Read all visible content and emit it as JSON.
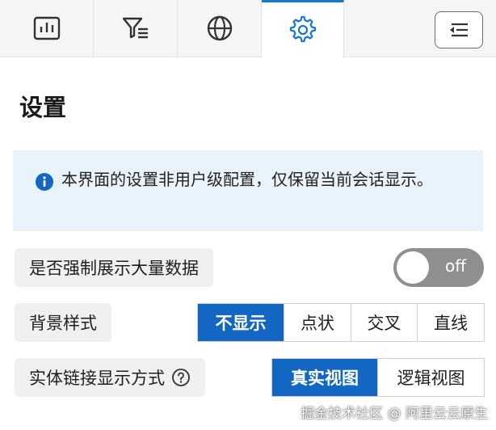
{
  "tabs": [
    {
      "name": "chart-icon",
      "active": false
    },
    {
      "name": "filter-icon",
      "active": false
    },
    {
      "name": "globe-icon",
      "active": false
    },
    {
      "name": "gear-icon",
      "active": true
    }
  ],
  "collapse_button": {
    "icon": "collapse-panel-icon"
  },
  "page_title": "设置",
  "notice": {
    "icon": "info-icon",
    "text": "本界面的设置非用户级配置，仅保留当前会话显示。"
  },
  "settings": {
    "force_display": {
      "label": "是否强制展示大量数据",
      "toggle_text": "off",
      "value": false
    },
    "background_style": {
      "label": "背景样式",
      "options": [
        "不显示",
        "点状",
        "交叉",
        "直线"
      ],
      "selected": "不显示"
    },
    "entity_link": {
      "label": "实体链接显示方式",
      "help_icon": "question-circle-icon",
      "options": [
        "真实视图",
        "逻辑视图"
      ],
      "selected": "真实视图"
    }
  },
  "watermark": "掘金技术社区 @ 阿里云云原生",
  "colors": {
    "accent": "#1366c2",
    "notice_bg": "#e9f3fc",
    "toggle_off": "#8f8f8f"
  }
}
